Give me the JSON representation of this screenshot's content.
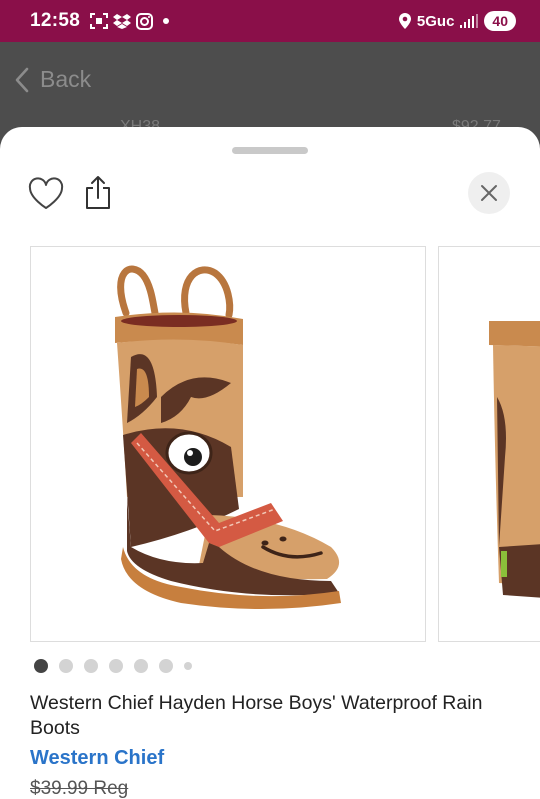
{
  "status_bar": {
    "time": "12:58",
    "network": "5Guc",
    "battery": "40",
    "icons": [
      "screenshot-icon",
      "dropbox-icon",
      "instagram-icon",
      "location-icon",
      "signal-icon"
    ]
  },
  "background_page": {
    "back_label": "Back",
    "price_fragment": "$92.77",
    "item_fragment": "XH38"
  },
  "sheet": {
    "icons": [
      "heart-icon",
      "share-icon",
      "close-icon"
    ],
    "carousel": {
      "slide_count": 7,
      "active_index": 0
    },
    "product": {
      "title": "Western Chief Hayden Horse Boys' Waterproof Rain Boots",
      "brand": "Western Chief",
      "price_reg": "$39.99 Reg"
    }
  },
  "colors": {
    "status_bar": "#8a0f49",
    "brand_link": "#2a74c9"
  }
}
